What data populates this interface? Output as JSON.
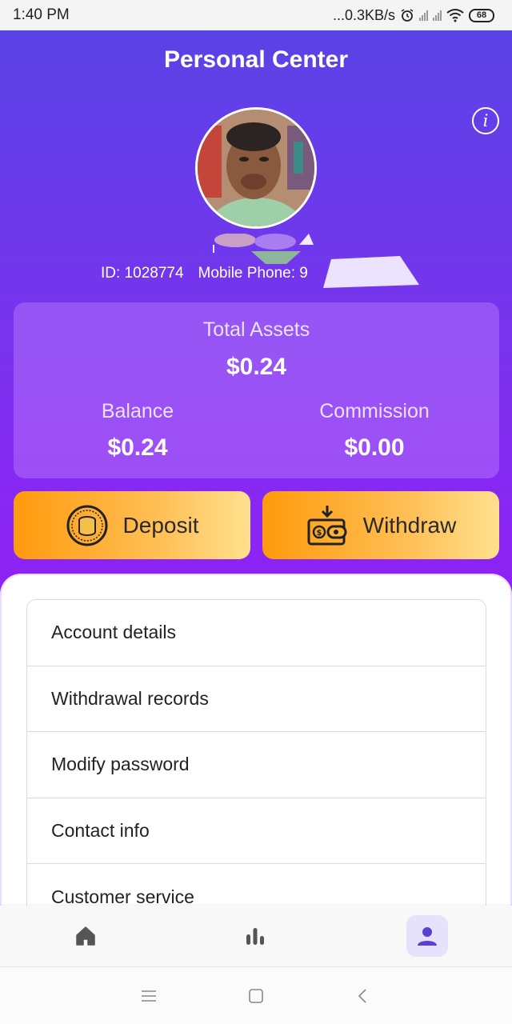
{
  "status_bar": {
    "time": "1:40 PM",
    "network_speed": "...0.3KB/s",
    "battery": "68",
    "icons": [
      "alarm-icon",
      "signal-icon",
      "signal-icon",
      "wifi-icon",
      "battery-icon"
    ]
  },
  "header": {
    "title": "Personal Center",
    "info_icon": "info-icon",
    "info_glyph": "i"
  },
  "profile": {
    "user_id": "ID: 1028774",
    "mobile_phone": "Mobile Phone: 9"
  },
  "assets": {
    "total_label": "Total Assets",
    "total_value": "$0.24",
    "balance_label": "Balance",
    "balance_value": "$0.24",
    "commission_label": "Commission",
    "commission_value": "$0.00"
  },
  "actions": {
    "deposit_label": "Deposit",
    "deposit_icon": "coins-icon",
    "withdraw_label": "Withdraw",
    "withdraw_icon": "wallet-icon"
  },
  "menu": [
    "Account details",
    "Withdrawal records",
    "Modify password",
    "Contact info",
    "Customer service"
  ],
  "bottom_nav": {
    "items": [
      "home-icon",
      "chart-icon",
      "user-icon"
    ],
    "active": "user-icon"
  },
  "colors": {
    "gradient_top": "#5a43e6",
    "gradient_bottom": "#9020f6",
    "button_orange": "#ff9a0c",
    "nav_active_bg": "#e6e2fb",
    "nav_active_icon": "#5b3fd6"
  }
}
